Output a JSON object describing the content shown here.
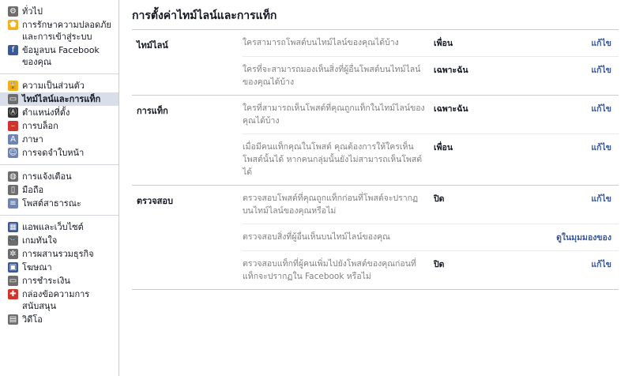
{
  "sidebar": {
    "group1": [
      {
        "label": "ทั่วไป",
        "icon": "gear-icon",
        "color": "#6d6d6d",
        "glyph": "⚙"
      },
      {
        "label": "การรักษาความปลอดภัยและการเข้าสู่ระบบ",
        "icon": "shield-icon",
        "color": "#f5b01e",
        "glyph": "⬟"
      },
      {
        "label": "ข้อมูลบน Facebook ของคุณ",
        "icon": "facebook-icon",
        "color": "#3b5998",
        "glyph": "f"
      }
    ],
    "group2": [
      {
        "label": "ความเป็นส่วนตัว",
        "icon": "lock-icon",
        "color": "#f5b01e",
        "glyph": "🔒"
      },
      {
        "label": "ไทม์ไลน์และการแท็ก",
        "icon": "timeline-icon",
        "color": "#6d6d6d",
        "glyph": "▭",
        "active": true
      },
      {
        "label": "ตำแหน่งที่ตั้ง",
        "icon": "location-icon",
        "color": "#333333",
        "glyph": "Ⓐ"
      },
      {
        "label": "การบล็อก",
        "icon": "block-icon",
        "color": "#d0342c",
        "glyph": "–"
      },
      {
        "label": "ภาษา",
        "icon": "language-icon",
        "color": "#6d84b4",
        "glyph": "A"
      },
      {
        "label": "การจดจำใบหน้า",
        "icon": "face-icon",
        "color": "#6d84b4",
        "glyph": "☺"
      }
    ],
    "group3": [
      {
        "label": "การแจ้งเตือน",
        "icon": "globe-icon",
        "color": "#6d6d6d",
        "glyph": "◍"
      },
      {
        "label": "มือถือ",
        "icon": "mobile-icon",
        "color": "#6d6d6d",
        "glyph": "▯"
      },
      {
        "label": "โพสต์สาธารณะ",
        "icon": "rss-icon",
        "color": "#6d84b4",
        "glyph": "≡"
      }
    ],
    "group4": [
      {
        "label": "แอพและเว็บไซต์",
        "icon": "apps-icon",
        "color": "#3b5998",
        "glyph": "▦"
      },
      {
        "label": "เกมทันใจ",
        "icon": "gamepad-icon",
        "color": "#6d6d6d",
        "glyph": "🎮"
      },
      {
        "label": "การผสานรวมธุรกิจ",
        "icon": "cog-icon",
        "color": "#6d6d6d",
        "glyph": "✲"
      },
      {
        "label": "โฆษณา",
        "icon": "ads-icon",
        "color": "#3b5998",
        "glyph": "▣"
      },
      {
        "label": "การชำระเงิน",
        "icon": "card-icon",
        "color": "#6d6d6d",
        "glyph": "▭"
      },
      {
        "label": "กล่องข้อความการสนับสนุน",
        "icon": "support-icon",
        "color": "#d0342c",
        "glyph": "✚"
      },
      {
        "label": "วิดีโอ",
        "icon": "video-icon",
        "color": "#6d6d6d",
        "glyph": "▤"
      }
    ]
  },
  "main": {
    "title": "การตั้งค่าไทม์ไลน์และการแท็ก",
    "edit_label": "แก้ไข",
    "sections": [
      {
        "label": "ไทม์ไลน์",
        "rows": [
          {
            "q": "ใครสามารถโพสต์บนไทม์ไลน์ของคุณได้บ้าง",
            "v": "เพื่อน",
            "action": "แก้ไข"
          },
          {
            "q": "ใครที่จะสามารถมองเห็นสิ่งที่ผู้อื่นโพสต์บนไทม์ไลน์ของคุณได้บ้าง",
            "v": "เฉพาะฉัน",
            "action": "แก้ไข"
          }
        ]
      },
      {
        "label": "การแท็ก",
        "rows": [
          {
            "q": "ใครที่สามารถเห็นโพสต์ที่คุณถูกแท็กในไทม์ไลน์ของคุณได้บ้าง",
            "v": "เฉพาะฉัน",
            "action": "แก้ไข"
          },
          {
            "q": "เมื่อมีคนแท็กคุณในโพสต์ คุณต้องการให้ใครเห็นโพสต์นั้นได้ หากคนกลุ่มนั้นยังไม่สามารถเห็นโพสต์ได้",
            "v": "เพื่อน",
            "action": "แก้ไข"
          }
        ]
      },
      {
        "label": "ตรวจสอบ",
        "rows": [
          {
            "q": "ตรวจสอบโพสต์ที่คุณถูกแท็กก่อนที่โพสต์จะปรากฏบนไทม์ไลน์ของคุณหรือไม่",
            "v": "ปิด",
            "action": "แก้ไข"
          },
          {
            "q": "ตรวจสอบสิ่งที่ผู้อื่นเห็นบนไทม์ไลน์ของคุณ",
            "v": "",
            "action": "ดูในมุมมองของ"
          },
          {
            "q": "ตรวจสอบแท็กที่ผู้คนเพิ่มไปยังโพสต์ของคุณก่อนที่แท็กจะปรากฏใน Facebook หรือไม่",
            "v": "ปิด",
            "action": "แก้ไข"
          }
        ]
      }
    ]
  }
}
